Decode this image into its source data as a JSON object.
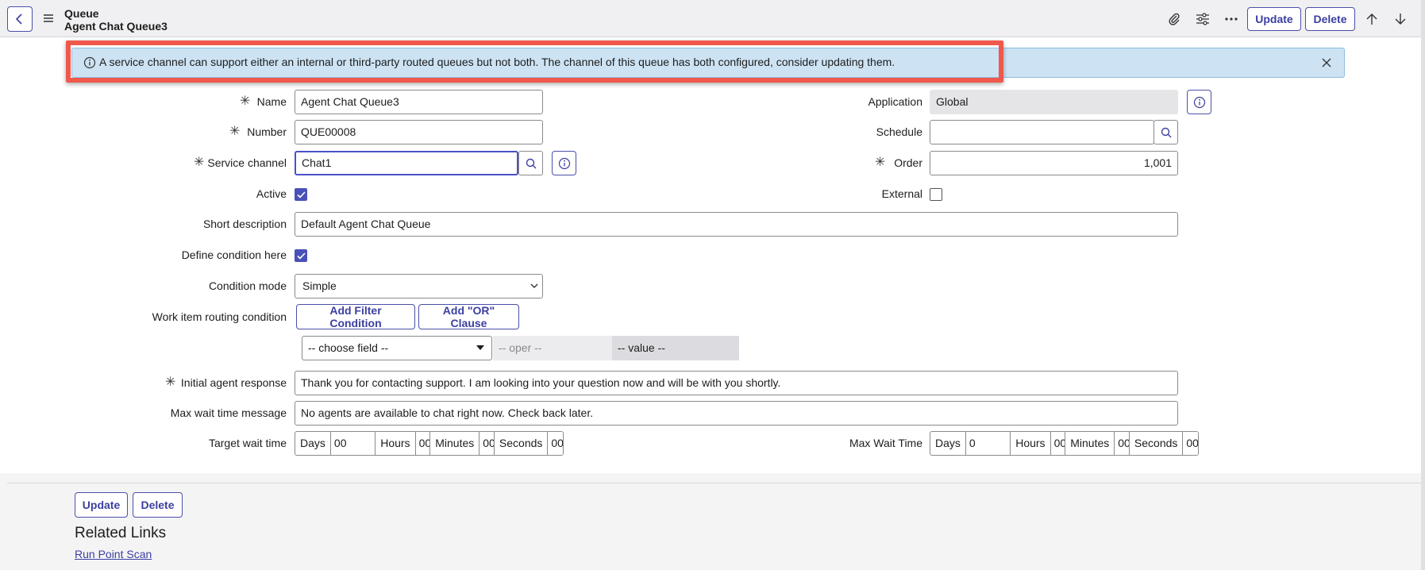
{
  "header": {
    "record_type": "Queue",
    "record_name": "Agent Chat Queue3",
    "update_label": "Update",
    "delete_label": "Delete"
  },
  "alert": {
    "message": "A service channel can support either an internal or third-party routed queues but not both. The channel of this queue has both configured, consider updating them."
  },
  "form": {
    "name": {
      "label": "Name",
      "value": "Agent Chat Queue3"
    },
    "number": {
      "label": "Number",
      "value": "QUE00008"
    },
    "service_channel": {
      "label": "Service channel",
      "value": "Chat1"
    },
    "active": {
      "label": "Active",
      "checked": true
    },
    "application": {
      "label": "Application",
      "value": "Global"
    },
    "schedule": {
      "label": "Schedule",
      "value": ""
    },
    "order": {
      "label": "Order",
      "value": "1,001"
    },
    "external": {
      "label": "External",
      "checked": false
    },
    "short_description": {
      "label": "Short description",
      "value": "Default Agent Chat Queue"
    },
    "define_condition": {
      "label": "Define condition here",
      "checked": true
    },
    "condition_mode": {
      "label": "Condition mode",
      "value": "Simple"
    },
    "routing_condition": {
      "label": "Work item routing condition",
      "add_filter_label": "Add Filter Condition",
      "add_or_label": "Add \"OR\" Clause",
      "field_placeholder": "-- choose field --",
      "oper_placeholder": "-- oper --",
      "value_placeholder": "-- value --"
    },
    "initial_response": {
      "label": "Initial agent response",
      "value": "Thank you for contacting support. I am looking into your question now and will be with you shortly."
    },
    "max_wait_message": {
      "label": "Max wait time message",
      "value": "No agents are available to chat right now. Check back later."
    },
    "target_wait": {
      "label": "Target wait time",
      "days_label": "Days",
      "days": "00",
      "hours_label": "Hours",
      "hours": "00",
      "minutes_label": "Minutes",
      "minutes": "00",
      "seconds_label": "Seconds",
      "seconds": "00"
    },
    "max_wait": {
      "label": "Max Wait Time",
      "days_label": "Days",
      "days": "0",
      "hours_label": "Hours",
      "hours": "00",
      "minutes_label": "Minutes",
      "minutes": "00",
      "seconds_label": "Seconds",
      "seconds": "00"
    }
  },
  "footer": {
    "update_label": "Update",
    "delete_label": "Delete",
    "related_title": "Related Links",
    "related_link": "Run Point Scan"
  },
  "colors": {
    "accent": "#3b3fa0",
    "alert_bg": "#cde3f3",
    "highlight_border": "#f0584c",
    "checkbox_on": "#4a50b8"
  }
}
